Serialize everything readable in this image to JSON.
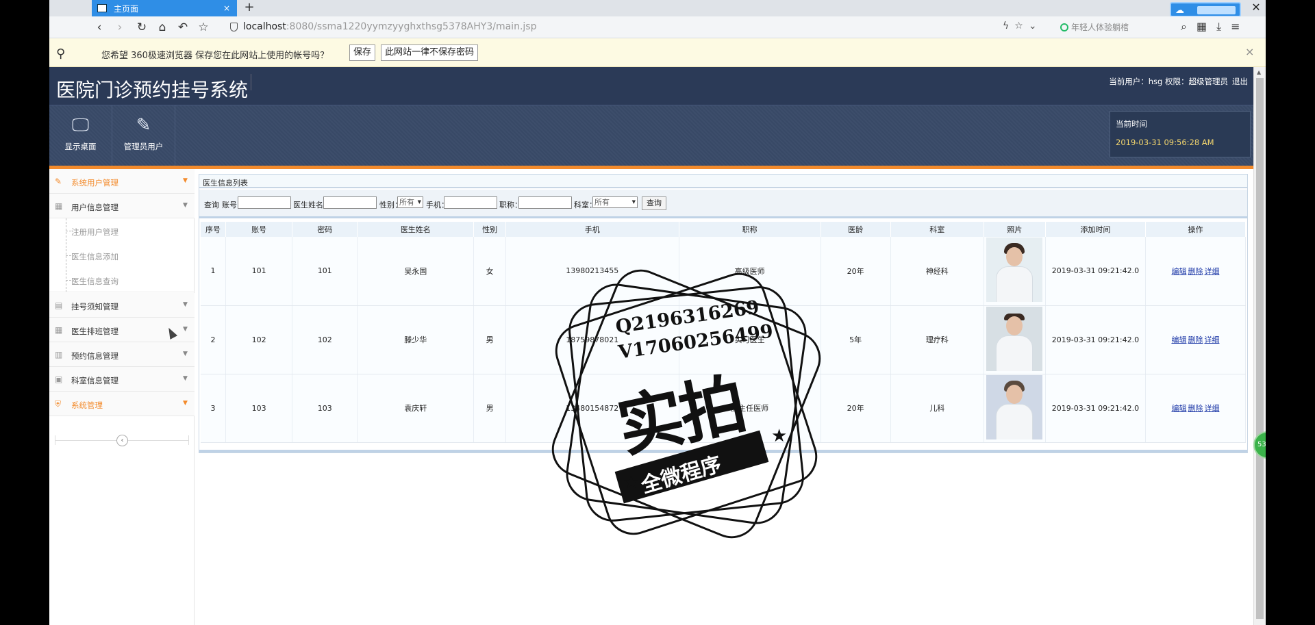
{
  "browser": {
    "tab_title": "主页面",
    "tab_close": "×",
    "new_tab": "+",
    "url_host": "localhost",
    "url_rest": ":8080/ssma1220yymzyyghxthsg5378AHY3/main.jsp",
    "search_placeholder": "年轻人体验躺棺",
    "window_close": "✕"
  },
  "savebar": {
    "message": "您希望 360极速浏览器 保存您在此网站上使用的帐号吗？",
    "save_label": "保存",
    "never_label": "此网站一律不保存密码",
    "close": "×"
  },
  "header": {
    "title": "医院门诊预约挂号系统",
    "user_text": "当前用户：hsg  权限：超级管理员",
    "logout": "退出"
  },
  "toolbar": {
    "desktop_label": "显示桌面",
    "admin_label": "管理员用户",
    "time_title": "当前时间",
    "time_value": "2019-03-31 09:56:28 AM"
  },
  "sidebar": {
    "m1": "系统用户管理",
    "m2": "用户信息管理",
    "s1": "注册用户管理",
    "s2": "医生信息添加",
    "s3": "医生信息查询",
    "m3": "挂号须知管理",
    "m4": "医生排班管理",
    "m5": "预约信息管理",
    "m6": "科室信息管理",
    "m7": "系统管理",
    "collapse": "‹"
  },
  "panel": {
    "title": "医生信息列表",
    "q_label": "查询",
    "q_account": "账号：",
    "q_name": "医生姓名：",
    "q_gender": "性别：",
    "q_gender_value": "所有",
    "q_phone": "手机：",
    "q_title": "职称：",
    "q_dept": "科室：",
    "q_dept_value": "所有",
    "q_button": "查询"
  },
  "table": {
    "headers": [
      "序号",
      "账号",
      "密码",
      "医生姓名",
      "性别",
      "手机",
      "职称",
      "医龄",
      "科室",
      "照片",
      "添加时间",
      "操作"
    ],
    "rows": [
      {
        "no": "1",
        "account": "101",
        "password": "101",
        "name": "吴永国",
        "gender": "女",
        "phone": "13980213455",
        "title": "高级医师",
        "years": "20年",
        "dept": "神经科",
        "time": "2019-03-31 09:21:42.0"
      },
      {
        "no": "2",
        "account": "102",
        "password": "102",
        "name": "滕少华",
        "gender": "男",
        "phone": "18759878021",
        "title": "实习医生",
        "years": "5年",
        "dept": "理疗科",
        "time": "2019-03-31 09:21:42.0"
      },
      {
        "no": "3",
        "account": "103",
        "password": "103",
        "name": "袁庆轩",
        "gender": "男",
        "phone": "13480154872",
        "title": "副主任医师",
        "years": "20年",
        "dept": "儿科",
        "time": "2019-03-31 09:21:42.0"
      }
    ],
    "action_edit": "编辑",
    "action_delete": "删除",
    "action_detail": "详细"
  },
  "watermark": {
    "line1": "Q2196316269",
    "line2": "V17060256499",
    "big": "实拍",
    "ribbon": "全微程序"
  },
  "float_ball": "53"
}
